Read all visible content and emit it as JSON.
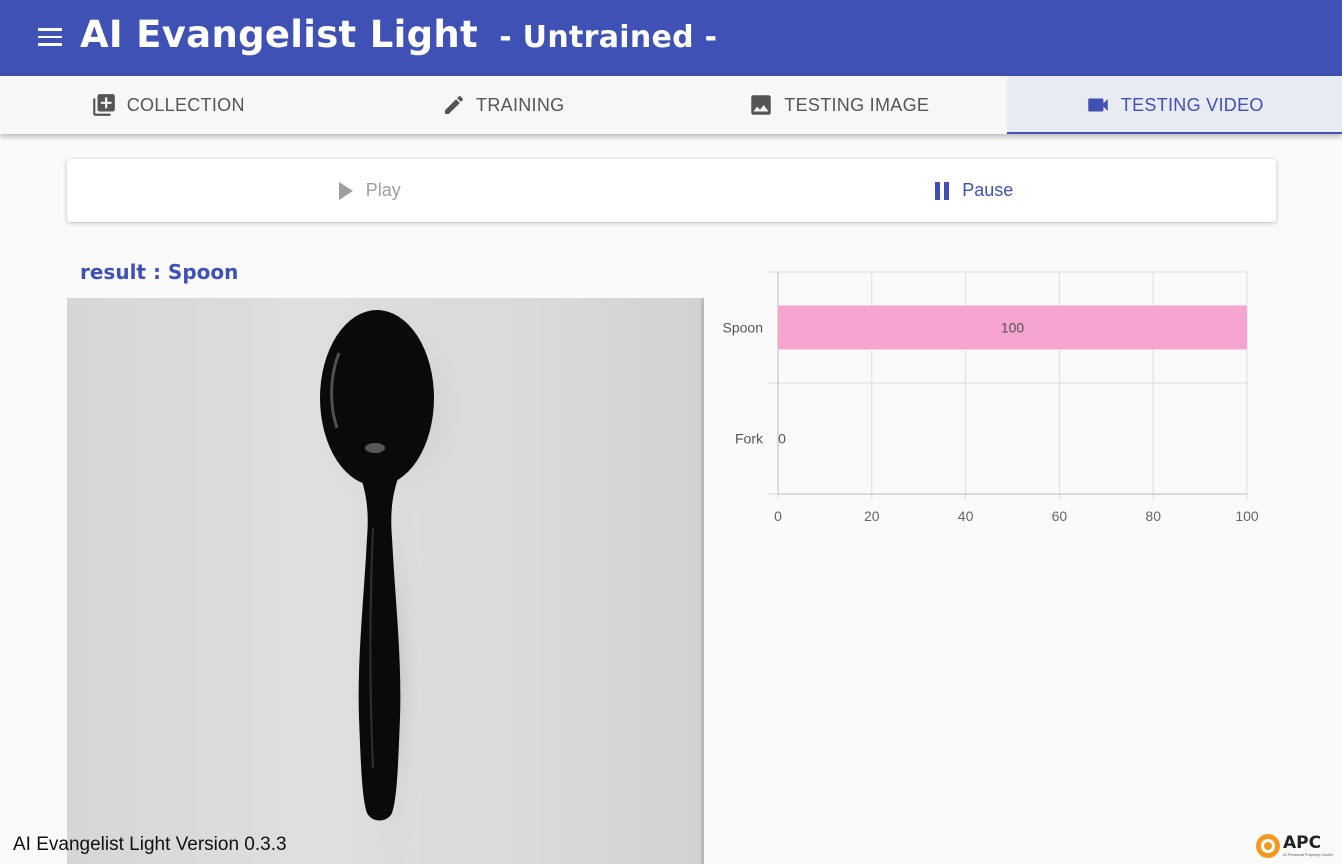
{
  "app": {
    "title": "AI Evangelist Light",
    "subtitle": "- Untrained -"
  },
  "icons": {
    "menu": "hamburger-menu-icon",
    "collection": "add-to-photos-icon",
    "training": "pencil-icon",
    "testing_image": "image-icon",
    "testing_video": "videocam-icon",
    "play": "play-icon",
    "pause": "pause-icon"
  },
  "tabs": [
    {
      "label": "COLLECTION",
      "active": false
    },
    {
      "label": "TRAINING",
      "active": false
    },
    {
      "label": "TESTING IMAGE",
      "active": false
    },
    {
      "label": "TESTING VIDEO",
      "active": true
    }
  ],
  "controls": {
    "play_label": "Play",
    "pause_label": "Pause"
  },
  "result": {
    "text": "result : Spoon"
  },
  "chart_data": {
    "type": "bar",
    "orientation": "horizontal",
    "categories": [
      "Spoon",
      "Fork"
    ],
    "values": [
      100,
      0
    ],
    "xlim": [
      0,
      100
    ],
    "xticks": [
      0,
      20,
      40,
      60,
      80,
      100
    ],
    "bar_color": "#f6a5d1",
    "grid": true
  },
  "footer": {
    "version_text": "AI Evangelist Light Version 0.3.3",
    "logo_text": "APC",
    "logo_subtext": "AI Personal Property Center"
  },
  "colors": {
    "primary": "#3f51b5",
    "bar": "#f6a5d1",
    "logo_orange": "#f29a1f"
  }
}
